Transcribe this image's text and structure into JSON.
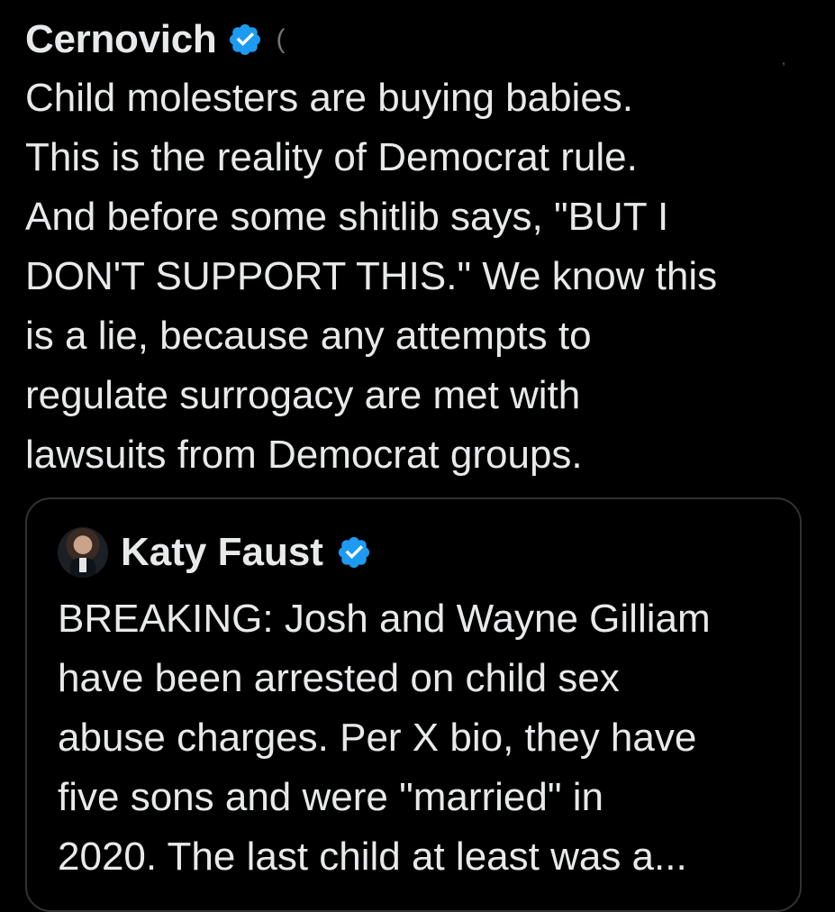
{
  "tweet": {
    "author_name": "Cernovich",
    "handle_fragment": "(",
    "trailing_mark": ",",
    "text": "Child molesters are buying babies.\nThis is the reality of Democrat rule.\nAnd before some shitlib says, \"BUT I\nDON'T SUPPORT THIS.\" We know this\nis a lie, because any attempts to\nregulate surrogacy are met with\nlawsuits from Democrat groups."
  },
  "quote": {
    "author_name": "Katy Faust",
    "text": "BREAKING: Josh and Wayne Gilliam\nhave been arrested on child sex\nabuse charges. Per X bio, they have\nfive sons and were \"married\" in\n2020. The last child at least was a..."
  },
  "colors": {
    "background": "#000000",
    "text": "#e7e9ea",
    "verified_badge": "#1d9bf0",
    "card_border": "#2f3336"
  },
  "icons": {
    "verified": "verified-badge-icon",
    "avatar": "avatar-image"
  }
}
